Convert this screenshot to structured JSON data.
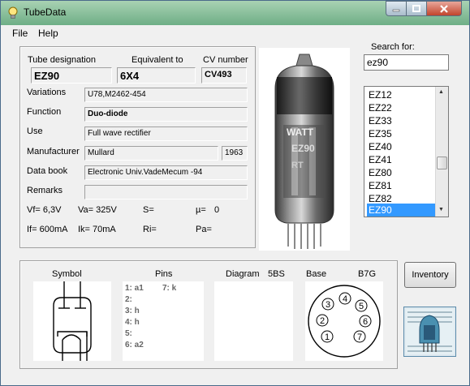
{
  "window": {
    "title": "TubeData"
  },
  "menu": {
    "file": "File",
    "help": "Help"
  },
  "details": {
    "tube_designation_label": "Tube designation",
    "tube_designation": "EZ90",
    "equivalent_label": "Equivalent to",
    "equivalent": "6X4",
    "cv_label": "CV number",
    "cv_number": "CV493",
    "variations_label": "Variations",
    "variations": "U78,M2462-454",
    "function_label": "Function",
    "function": "Duo-diode",
    "use_label": "Use",
    "use": "Full wave rectifier",
    "manufacturer_label": "Manufacturer",
    "manufacturer": "Mullard",
    "year": "1963",
    "databook_label": "Data book",
    "databook": "Electronic Univ.VadeMecum -94",
    "remarks_label": "Remarks",
    "remarks": "",
    "params": {
      "vf": "Vf= 6,3V",
      "va": "Va=  325V",
      "s": "S=",
      "mu": "µ=",
      "mu_val": "0",
      "if": "If= 600mA",
      "ik": "Ik=  70mA",
      "ri": "Ri=",
      "pa": "Pa="
    }
  },
  "photo": {
    "marking_top": "WATT",
    "marking_mid": "EZ90",
    "marking_bot": "RT"
  },
  "search": {
    "label": "Search for:",
    "value": "ez90",
    "results": [
      "EZ12",
      "EZ22",
      "EZ33",
      "EZ35",
      "EZ40",
      "EZ41",
      "EZ80",
      "EZ81",
      "EZ82",
      "EZ90"
    ],
    "selected": "EZ90"
  },
  "bottom": {
    "symbol_label": "Symbol",
    "pins_label": "Pins",
    "diagram_label": "Diagram",
    "diagram_code": "5BS",
    "base_label": "Base",
    "base_code": "B7G",
    "pins": [
      "1: a1",
      "2:",
      "3: h",
      "4: h",
      "5:",
      "6: a2"
    ],
    "pin7": "7: k",
    "base_pins": [
      "1",
      "2",
      "3",
      "4",
      "5",
      "6",
      "7"
    ]
  },
  "buttons": {
    "inventory": "Inventory"
  },
  "colors": {
    "selection": "#3399ff",
    "titlebar": "#6eae86",
    "close": "#c2442c"
  }
}
